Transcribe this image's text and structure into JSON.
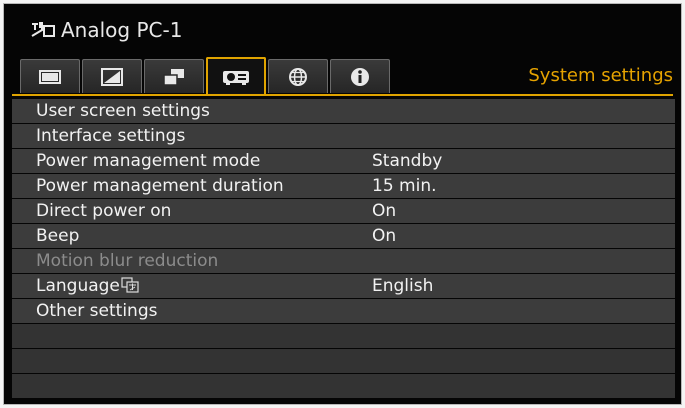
{
  "header": {
    "source_icon": "analog-pc-input-icon",
    "source_label": "Analog PC-1",
    "section_title": "System settings"
  },
  "tabs": [
    {
      "icon": "screen-icon",
      "active": false
    },
    {
      "icon": "image-adjust-icon",
      "active": false
    },
    {
      "icon": "display-layout-icon",
      "active": false
    },
    {
      "icon": "projector-icon",
      "active": true
    },
    {
      "icon": "globe-icon",
      "active": false
    },
    {
      "icon": "info-icon",
      "active": false
    }
  ],
  "menu": {
    "items": [
      {
        "label": "User screen settings",
        "value": "",
        "enabled": true
      },
      {
        "label": "Interface settings",
        "value": "",
        "enabled": true
      },
      {
        "label": "Power management mode",
        "value": "Standby",
        "enabled": true
      },
      {
        "label": "Power management duration",
        "value": "15 min.",
        "enabled": true
      },
      {
        "label": "Direct power on",
        "value": "On",
        "enabled": true
      },
      {
        "label": "Beep",
        "value": "On",
        "enabled": true
      },
      {
        "label": "Motion blur reduction",
        "value": "",
        "enabled": false
      },
      {
        "label": "Language",
        "value": "English",
        "enabled": true,
        "icon": "language-icon"
      },
      {
        "label": "Other settings",
        "value": "",
        "enabled": true
      }
    ]
  },
  "colors": {
    "accent": "#e6a300",
    "row_bg": "#3c3c3c",
    "text": "#f2f2f2",
    "disabled_text": "#8c8c8c"
  }
}
